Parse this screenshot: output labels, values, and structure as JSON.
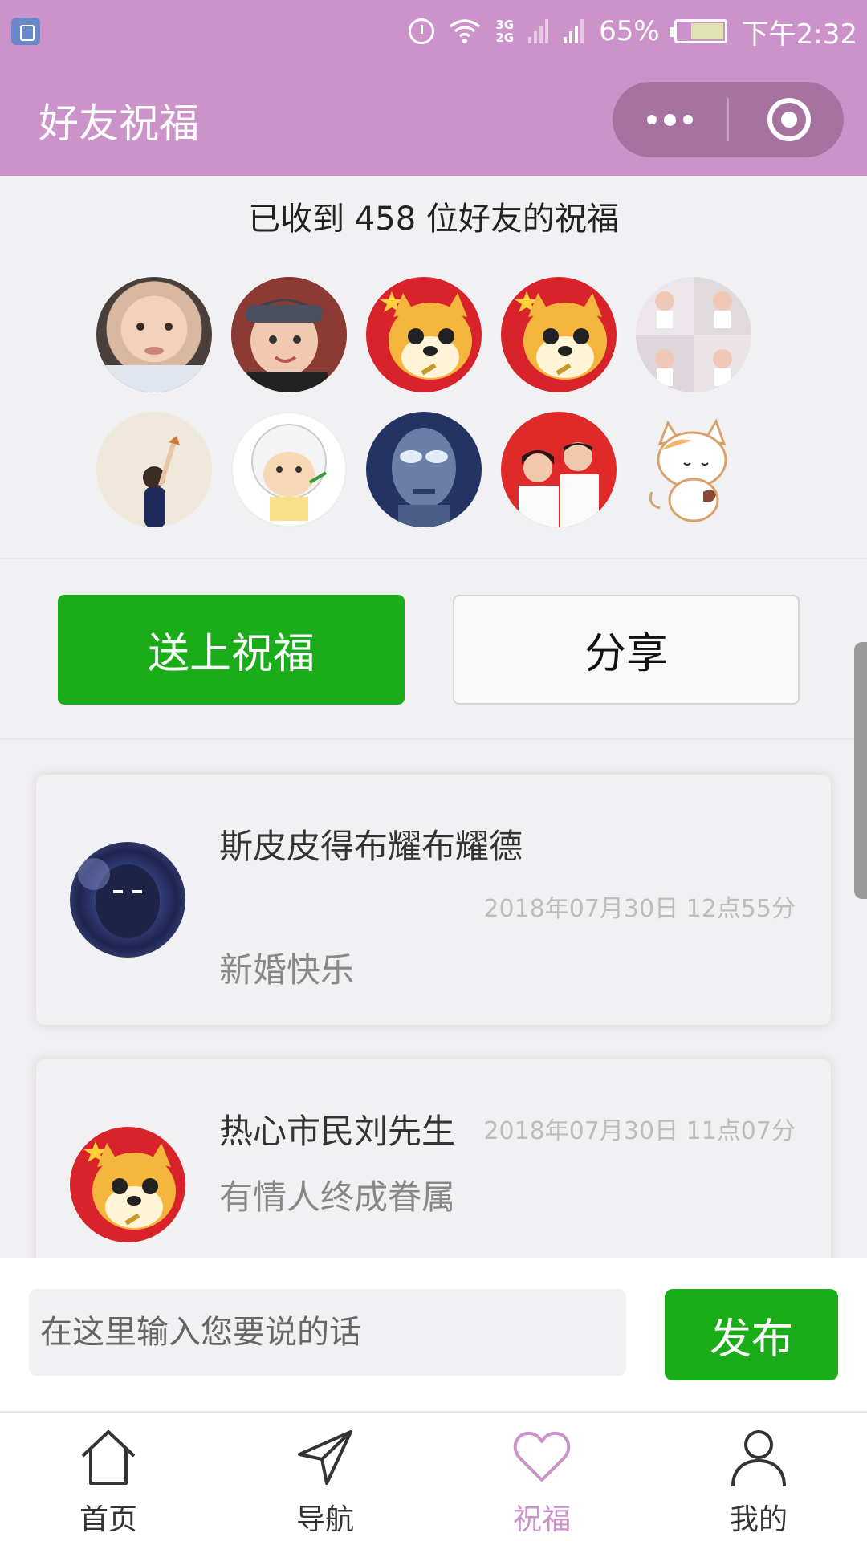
{
  "status_bar": {
    "network": "3G\n2G",
    "battery": "65%",
    "time": "下午2:32"
  },
  "navbar": {
    "title": "好友祝福"
  },
  "summary": {
    "count_text": "已收到 458 位好友的祝福"
  },
  "avatars": [
    {
      "name": "baby-avatar"
    },
    {
      "name": "child-avatar"
    },
    {
      "name": "doge-avatar"
    },
    {
      "name": "doge-avatar"
    },
    {
      "name": "baby-grid-avatar"
    },
    {
      "name": "girl-avatar"
    },
    {
      "name": "sheep-avatar"
    },
    {
      "name": "blue-face-avatar"
    },
    {
      "name": "couple-avatar"
    },
    {
      "name": "cat-sticker-avatar"
    }
  ],
  "actions": {
    "bless": "送上祝福",
    "share": "分享"
  },
  "messages": [
    {
      "name": "斯皮皮得布耀布耀德",
      "time": "2018年07月30日 12点55分",
      "text": "新婚快乐"
    },
    {
      "name": "热心市民刘先生",
      "time": "2018年07月30日 11点07分",
      "text": "有情人终成眷属"
    }
  ],
  "composer": {
    "placeholder": "在这里输入您要说的话",
    "publish": "发布"
  },
  "tabs": [
    {
      "label": "首页",
      "icon": "home-icon"
    },
    {
      "label": "导航",
      "icon": "navigation-icon"
    },
    {
      "label": "祝福",
      "icon": "heart-icon"
    },
    {
      "label": "我的",
      "icon": "user-icon"
    }
  ],
  "colors": {
    "theme": "#cb93ca",
    "primary_green": "#1aad19"
  }
}
